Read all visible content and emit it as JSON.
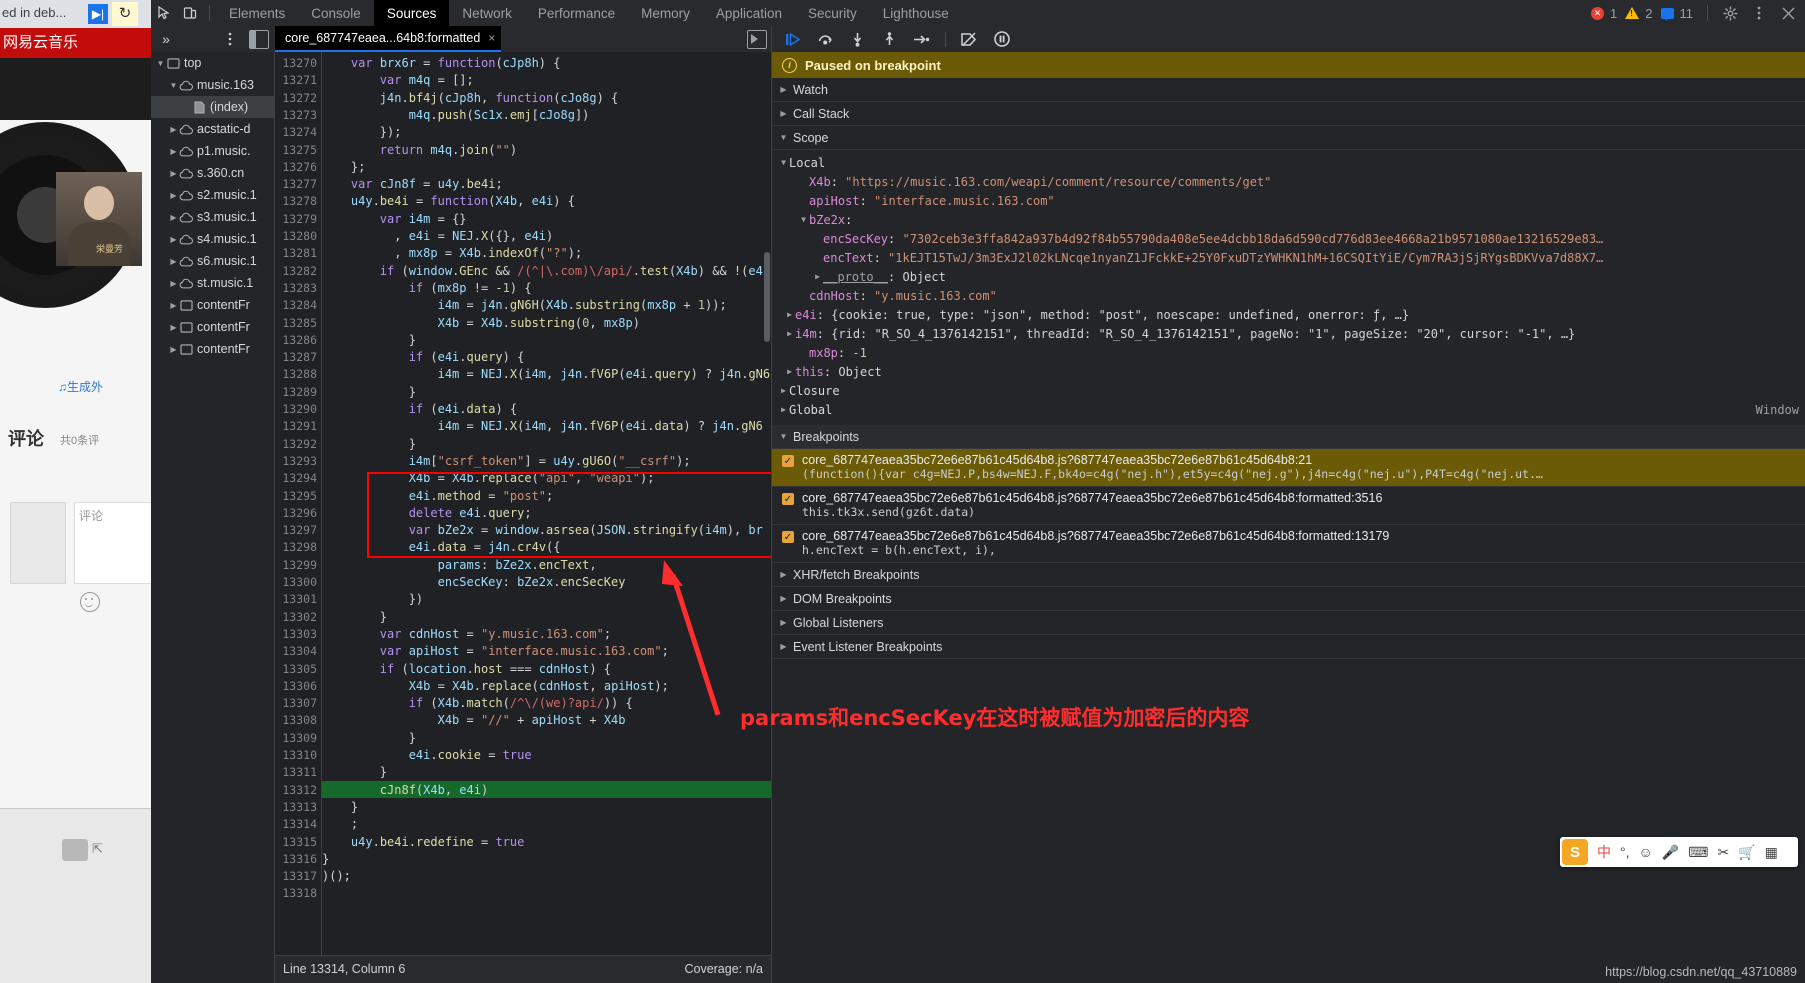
{
  "background_page": {
    "tab_title": "ed in deb...",
    "play_icon": "play-icon",
    "reload_icon": "reload-icon",
    "site_title": "网易云音乐",
    "generate_link": "♫生成外",
    "comment_heading": "评论",
    "comment_count": "共0条评",
    "comment_placeholder": "评论",
    "emoji_icon": "emoji-icon",
    "photo_caption": "栄曼芳"
  },
  "devtools": {
    "toolbar": {
      "inspect_icon": "inspect-element-icon",
      "device_icon": "device-toolbar-icon",
      "tabs": [
        {
          "label": "Elements",
          "active": false
        },
        {
          "label": "Console",
          "active": false
        },
        {
          "label": "Sources",
          "active": true
        },
        {
          "label": "Network",
          "active": false
        },
        {
          "label": "Performance",
          "active": false
        },
        {
          "label": "Memory",
          "active": false
        },
        {
          "label": "Application",
          "active": false
        },
        {
          "label": "Security",
          "active": false
        },
        {
          "label": "Lighthouse",
          "active": false
        }
      ],
      "error_count": "1",
      "warning_count": "2",
      "message_count": "11",
      "settings_icon": "gear-icon",
      "more_icon": "more-vertical-icon",
      "close_icon": "close-icon"
    },
    "secondrow": {
      "more_tabs_icon": "chevron-double-right-icon",
      "panel_menu_icon": "more-vertical-icon",
      "show_navigator_icon": "show-navigator-icon",
      "file_tab_label": "core_687747eaea...64b8:formatted",
      "file_tab_close": "×",
      "tab_extra_icon": "show-debugger-icon"
    },
    "debug_toolbar": {
      "resume_icon": "resume-script-icon",
      "step_over_icon": "step-over-icon",
      "step_into_icon": "step-into-icon",
      "step_out_icon": "step-out-icon",
      "step_icon": "step-icon",
      "deactivate_breakpoints_icon": "deactivate-breakpoints-icon",
      "pause_on_exceptions_icon": "pause-on-exceptions-icon"
    },
    "navigator": {
      "items": [
        {
          "label": "top",
          "icon": "frame-icon",
          "indent": 0,
          "expanded": true,
          "selected": false
        },
        {
          "label": "music.163",
          "icon": "cloud-icon",
          "indent": 1,
          "expanded": true,
          "selected": false
        },
        {
          "label": "(index)",
          "icon": "document-icon",
          "indent": 2,
          "expanded": null,
          "selected": true
        },
        {
          "label": "acstatic-d",
          "icon": "cloud-icon",
          "indent": 1,
          "expanded": false,
          "selected": false
        },
        {
          "label": "p1.music.",
          "icon": "cloud-icon",
          "indent": 1,
          "expanded": false,
          "selected": false
        },
        {
          "label": "s.360.cn",
          "icon": "cloud-icon",
          "indent": 1,
          "expanded": false,
          "selected": false
        },
        {
          "label": "s2.music.1",
          "icon": "cloud-icon",
          "indent": 1,
          "expanded": false,
          "selected": false
        },
        {
          "label": "s3.music.1",
          "icon": "cloud-icon",
          "indent": 1,
          "expanded": false,
          "selected": false
        },
        {
          "label": "s4.music.1",
          "icon": "cloud-icon",
          "indent": 1,
          "expanded": false,
          "selected": false
        },
        {
          "label": "s6.music.1",
          "icon": "cloud-icon",
          "indent": 1,
          "expanded": false,
          "selected": false
        },
        {
          "label": "st.music.1",
          "icon": "cloud-icon",
          "indent": 1,
          "expanded": false,
          "selected": false
        },
        {
          "label": "contentFr",
          "icon": "frame-icon",
          "indent": 1,
          "expanded": false,
          "selected": false
        },
        {
          "label": "contentFr",
          "icon": "frame-icon",
          "indent": 1,
          "expanded": false,
          "selected": false
        },
        {
          "label": "contentFr",
          "icon": "frame-icon",
          "indent": 1,
          "expanded": false,
          "selected": false
        }
      ]
    },
    "editor": {
      "first_line_number": 13270,
      "execution_line": 13312,
      "highlight_start_line": 13297,
      "highlight_end_line": 13301,
      "lines": [
        {
          "n": 13270,
          "text": "    var brx6r = function(cJp8h) {"
        },
        {
          "n": 13271,
          "text": "        var m4q = [];"
        },
        {
          "n": 13272,
          "text": "        j4n.bf4j(cJp8h, function(cJo8g) {"
        },
        {
          "n": 13273,
          "text": "            m4q.push(Sc1x.emj[cJo8g])"
        },
        {
          "n": 13274,
          "text": "        });"
        },
        {
          "n": 13275,
          "text": "        return m4q.join(\"\")"
        },
        {
          "n": 13276,
          "text": "    };"
        },
        {
          "n": 13277,
          "text": "    var cJn8f = u4y.be4i;"
        },
        {
          "n": 13278,
          "text": "    u4y.be4i = function(X4b, e4i) {"
        },
        {
          "n": 13279,
          "text": "        var i4m = {}"
        },
        {
          "n": 13280,
          "text": "          , e4i = NEJ.X({}, e4i)"
        },
        {
          "n": 13281,
          "text": "          , mx8p = X4b.indexOf(\"?\");"
        },
        {
          "n": 13282,
          "text": "        if (window.GEnc && /(^|\\.com)\\/api/.test(X4b) && !(e4i"
        },
        {
          "n": 13283,
          "text": "            if (mx8p != -1) {"
        },
        {
          "n": 13284,
          "text": "                i4m = j4n.gN6H(X4b.substring(mx8p + 1));"
        },
        {
          "n": 13285,
          "text": "                X4b = X4b.substring(0, mx8p)"
        },
        {
          "n": 13286,
          "text": "            }"
        },
        {
          "n": 13287,
          "text": "            if (e4i.query) {"
        },
        {
          "n": 13288,
          "text": "                i4m = NEJ.X(i4m, j4n.fV6P(e4i.query) ? j4n.gN6"
        },
        {
          "n": 13289,
          "text": "            }"
        },
        {
          "n": 13290,
          "text": "            if (e4i.data) {"
        },
        {
          "n": 13291,
          "text": "                i4m = NEJ.X(i4m, j4n.fV6P(e4i.data) ? j4n.gN6"
        },
        {
          "n": 13292,
          "text": "            }"
        },
        {
          "n": 13293,
          "text": "            i4m[\"csrf_token\"] = u4y.gU6O(\"__csrf\");"
        },
        {
          "n": 13294,
          "text": "            X4b = X4b.replace(\"api\", \"weapi\");"
        },
        {
          "n": 13295,
          "text": "            e4i.method = \"post\";"
        },
        {
          "n": 13296,
          "text": "            delete e4i.query;"
        },
        {
          "n": 13297,
          "text": "            var bZe2x = window.asrsea(JSON.stringify(i4m), br"
        },
        {
          "n": 13298,
          "text": "            e4i.data = j4n.cr4v({"
        },
        {
          "n": 13299,
          "text": "                params: bZe2x.encText,"
        },
        {
          "n": 13300,
          "text": "                encSecKey: bZe2x.encSecKey"
        },
        {
          "n": 13301,
          "text": "            })"
        },
        {
          "n": 13302,
          "text": "        }"
        },
        {
          "n": 13303,
          "text": "        var cdnHost = \"y.music.163.com\";"
        },
        {
          "n": 13304,
          "text": "        var apiHost = \"interface.music.163.com\";"
        },
        {
          "n": 13305,
          "text": "        if (location.host === cdnHost) {"
        },
        {
          "n": 13306,
          "text": "            X4b = X4b.replace(cdnHost, apiHost);"
        },
        {
          "n": 13307,
          "text": "            if (X4b.match(/^\\/(we)?api/)) {"
        },
        {
          "n": 13308,
          "text": "                X4b = \"//\" + apiHost + X4b"
        },
        {
          "n": 13309,
          "text": "            }"
        },
        {
          "n": 13310,
          "text": "            e4i.cookie = true"
        },
        {
          "n": 13311,
          "text": "        }"
        },
        {
          "n": 13312,
          "text": "        cJn8f(X4b, e4i)"
        },
        {
          "n": 13313,
          "text": "    }"
        },
        {
          "n": 13314,
          "text": "    ;"
        },
        {
          "n": 13315,
          "text": "    u4y.be4i.redefine = true"
        },
        {
          "n": 13316,
          "text": "}"
        },
        {
          "n": 13317,
          "text": ")();"
        },
        {
          "n": 13318,
          "text": ""
        }
      ]
    },
    "statusbar": {
      "position": "Line 13314, Column 6",
      "coverage": "Coverage: n/a"
    },
    "debugger": {
      "paused_message": "Paused on breakpoint",
      "sections": [
        {
          "label": "Watch",
          "expanded": false
        },
        {
          "label": "Call Stack",
          "expanded": false
        },
        {
          "label": "Scope",
          "expanded": true
        }
      ],
      "scope": {
        "local_label": "Local",
        "entries": [
          {
            "name": "X4b",
            "value": "\"https://music.163.com/weapi/comment/resource/comments/get\"",
            "kind": "str",
            "indent": 1,
            "tri": false
          },
          {
            "name": "apiHost",
            "value": "\"interface.music.163.com\"",
            "kind": "str",
            "indent": 1,
            "tri": false
          },
          {
            "name": "bZe2x",
            "value": "",
            "kind": "obj",
            "indent": 1,
            "tri": true,
            "expanded": true
          },
          {
            "name": "encSecKey",
            "value": "\"7302ceb3e3ffa842a937b4d92f84b55790da408e5ee4dcbb18da6d590cd776d83ee4668a21b9571080ae13216529e83…",
            "kind": "str",
            "indent": 2,
            "tri": false
          },
          {
            "name": "encText",
            "value": "\"1kEJT15TwJ/3m3ExJ2l02kLNcqe1nyanZ1JFckkE+25Y0FxuDTzYWHKN1hM+16CSQItYiE/Cym7RA3jSjRYgsBDKVva7d88X7…",
            "kind": "str",
            "indent": 2,
            "tri": false
          },
          {
            "name": "__proto__",
            "value": "Object",
            "kind": "obj",
            "indent": 2,
            "tri": true,
            "expanded": false
          },
          {
            "name": "cdnHost",
            "value": "\"y.music.163.com\"",
            "kind": "str",
            "indent": 1,
            "tri": false
          },
          {
            "name": "e4i",
            "value": "{cookie: true, type: \"json\", method: \"post\", noescape: undefined, onerror: ƒ, …}",
            "kind": "mixed",
            "indent": 0,
            "tri": true,
            "expanded": false
          },
          {
            "name": "i4m",
            "value": "{rid: \"R_SO_4_1376142151\", threadId: \"R_SO_4_1376142151\", pageNo: \"1\", pageSize: \"20\", cursor: \"-1\", …}",
            "kind": "mixed",
            "indent": 0,
            "tri": true,
            "expanded": false
          },
          {
            "name": "mx8p",
            "value": "-1",
            "kind": "num",
            "indent": 1,
            "tri": false
          },
          {
            "name": "this",
            "value": "Object",
            "kind": "obj",
            "indent": 0,
            "tri": true,
            "expanded": false
          }
        ],
        "closure_label": "Closure",
        "global_label": "Global",
        "global_right_label": "Window"
      },
      "breakpoints_label": "Breakpoints",
      "breakpoints": [
        {
          "location": "core_687747eaea35bc72e6e87b61c45d64b8.js?687747eaea35bc72e6e87b61c45d64b8:21",
          "snippet": "(function(){var c4g=NEJ.P,bs4w=NEJ.F,bk4o=c4g(\"nej.h\"),et5y=c4g(\"nej.g\"),j4n=c4g(\"nej.u\"),P4T=c4g(\"nej.ut.…",
          "checked": true,
          "highlighted": true
        },
        {
          "location": "core_687747eaea35bc72e6e87b61c45d64b8.js?687747eaea35bc72e6e87b61c45d64b8:formatted:3516",
          "snippet": "this.tk3x.send(gz6t.data)",
          "checked": true,
          "highlighted": false
        },
        {
          "location": "core_687747eaea35bc72e6e87b61c45d64b8.js?687747eaea35bc72e6e87b61c45d64b8:formatted:13179",
          "snippet": "h.encText = b(h.encText, i),",
          "checked": true,
          "highlighted": false
        }
      ],
      "lower_sections": [
        {
          "label": "XHR/fetch Breakpoints",
          "expanded": false
        },
        {
          "label": "DOM Breakpoints",
          "expanded": false
        },
        {
          "label": "Global Listeners",
          "expanded": false
        },
        {
          "label": "Event Listener Breakpoints",
          "expanded": false
        }
      ]
    }
  },
  "annotations": {
    "red_note": "params和encSecKey在这时被赋值为加密后的内容",
    "arrow_icon": "red-arrow-icon",
    "box_icon": "red-highlight-box"
  },
  "ime_bar": {
    "logo": "S",
    "items": [
      "中",
      "°,",
      "☺",
      "🎤",
      "⌨",
      "✂",
      "🛒",
      "▦"
    ]
  },
  "watermark": "https://blog.csdn.net/qq_43710889",
  "colors": {
    "accent_blue": "#1a73e8",
    "paused_yellow": "#6b5a06",
    "annotation_red": "#ff2d2d",
    "exec_green": "#15692b",
    "bp_orange": "#e8a33d"
  }
}
